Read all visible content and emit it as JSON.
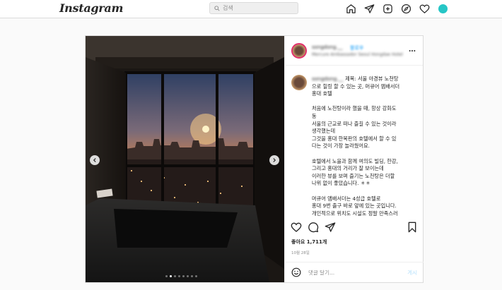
{
  "nav": {
    "logo": "Instagram",
    "search_placeholder": "검색",
    "icons": [
      "home-icon",
      "direct-message-icon",
      "new-post-icon",
      "explore-icon",
      "activity-heart-icon",
      "profile-avatar"
    ]
  },
  "post": {
    "username": "songdong.__",
    "follow_label": "팔로우",
    "location": "Mercure Ambassador Seoul Hongdae Hotel",
    "caption_lines": [
      "제목: 서울 야경뷰 노천탕",
      "으로 힐링 할 수 있는 곳, 머큐어 앰배서더",
      "홍대 호텔",
      "",
      "처음에 노천탕이라 했을 때, 항상 강화도",
      "동",
      "서울의 근교로 떠나 즐길 수 있는 것이라",
      "생각했는데",
      "그것을 홍대 한복판의 호텔에서 할 수 있",
      "다는 것이 가장 놀라웠어요.",
      "",
      "호텔에서 노을과 함께 여의도 빌딩, 한강,",
      "그리고 홍대의 거리가 잘 보이는데",
      "이러한 뷰를 보며 즐기는 노천탕은 더할",
      "나위 없이 좋았습니다. ＊＊",
      "",
      "머큐어 앰배서더는 4성급 호텔로",
      "홍대 9번 출구 바로 앞에 있는 곳입니다.",
      "개인적으로 위치도 시설도 정말 만족스러"
    ],
    "likes": "좋아요 1,711개",
    "date": "10월 28일",
    "comment_placeholder": "댓글 달기...",
    "post_button": "게시",
    "carousel_dots": 8,
    "active_dot": 1
  },
  "colors": {
    "accent_blue": "#0095f6",
    "post_button_disabled": "#b2dffc",
    "sunset_orange": "#f08a3a",
    "avatar_teal": "#26c6c6"
  }
}
